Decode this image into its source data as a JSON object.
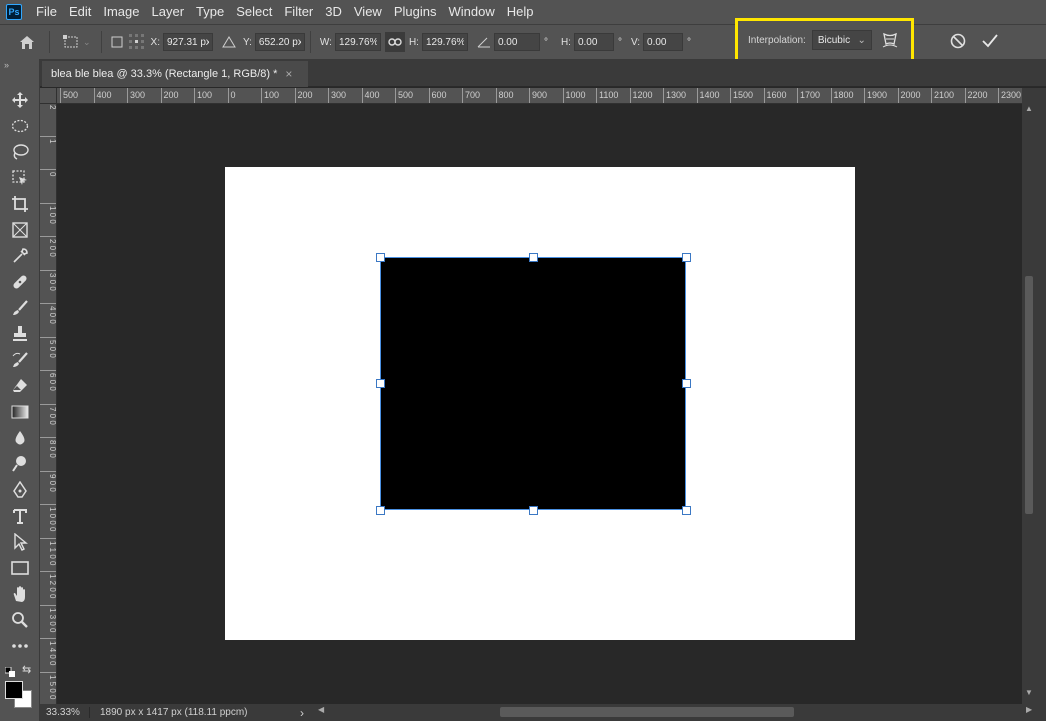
{
  "menubar": {
    "logo": "Ps",
    "items": [
      "File",
      "Edit",
      "Image",
      "Layer",
      "Type",
      "Select",
      "Filter",
      "3D",
      "View",
      "Plugins",
      "Window",
      "Help"
    ]
  },
  "options": {
    "x_label": "X:",
    "x_value": "927.31 px",
    "y_label": "Y:",
    "y_value": "652.20 px",
    "w_label": "W:",
    "w_value": "129.76%",
    "h_label": "H:",
    "h_value": "129.76%",
    "angle_value": "0.00",
    "hskew_label": "H:",
    "hskew_value": "0.00",
    "vskew_label": "V:",
    "vskew_value": "0.00",
    "degree": "°",
    "interpolation_label": "Interpolation:",
    "interpolation_value": "Bicubic",
    "cancel_glyph": "⃠",
    "commit_glyph": "✓"
  },
  "tab": {
    "title": "blea ble blea @ 33.3% (Rectangle 1, RGB/8) *",
    "close": "×"
  },
  "ruler_h": [
    "500",
    "400",
    "300",
    "200",
    "100",
    "0",
    "100",
    "200",
    "300",
    "400",
    "500",
    "600",
    "700",
    "800",
    "900",
    "1000",
    "1100",
    "1200",
    "1300",
    "1400",
    "1500",
    "1600",
    "1700",
    "1800",
    "1900",
    "2000",
    "2100",
    "2200",
    "2300"
  ],
  "ruler_v": [
    "2",
    "1",
    "0",
    "1 0 0",
    "2 0 0",
    "3 0 0",
    "4 0 0",
    "5 0 0",
    "6 0 0",
    "7 0 0",
    "8 0 0",
    "9 0 0",
    "1 0 0 0",
    "1 1 0 0",
    "1 2 0 0",
    "1 3 0 0",
    "1 4 0 0",
    "1 5 0 0"
  ],
  "status": {
    "zoom": "33.33%",
    "info": "1890 px x 1417 px (118.11 ppcm)",
    "arrow": "›"
  },
  "colors": {
    "highlight": "#ffe600",
    "selection": "#3b78c4"
  }
}
